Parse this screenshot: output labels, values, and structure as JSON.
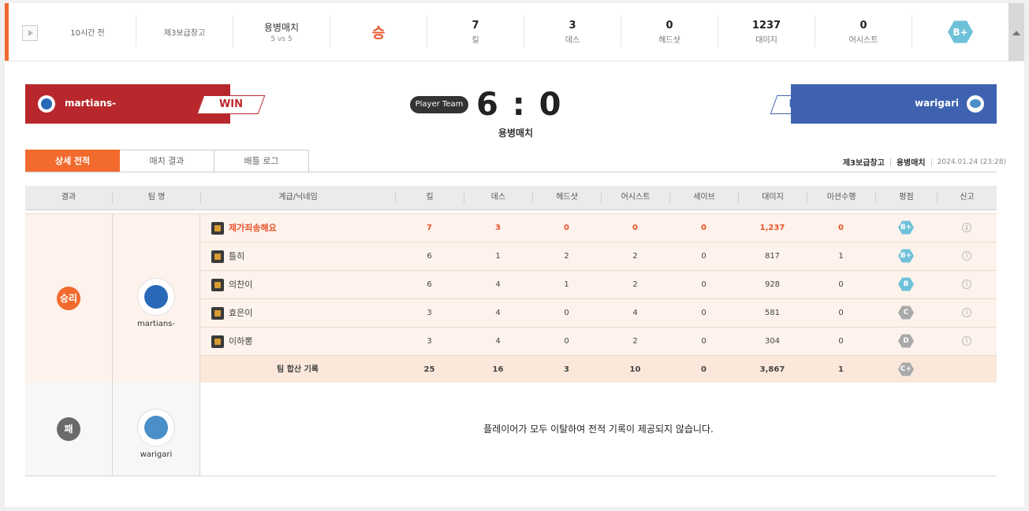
{
  "summary": {
    "time_ago": "10시간 전",
    "map": "제3보급창고",
    "mode": "용병매치",
    "mode_sub": "5 vs 5",
    "result": "승",
    "stats": [
      {
        "value": "7",
        "label": "킬"
      },
      {
        "value": "3",
        "label": "데스"
      },
      {
        "value": "0",
        "label": "헤드샷"
      },
      {
        "value": "1237",
        "label": "대미지"
      },
      {
        "value": "0",
        "label": "어시스트"
      }
    ],
    "grade": "B+"
  },
  "scoreboard": {
    "left_team": "martians-",
    "left_tag": "WIN",
    "right_team": "warigari",
    "right_tag": "LOSE",
    "player_team_badge": "Player Team",
    "score": "6 : 0",
    "mode": "용병매치"
  },
  "tabs": [
    {
      "label": "상세 전적",
      "active": true
    },
    {
      "label": "매치 결과",
      "active": false
    },
    {
      "label": "배틀 로그",
      "active": false
    }
  ],
  "meta": {
    "map": "제3보급창고",
    "mode": "용병매치",
    "datetime": "2024.01.24 (23:28)"
  },
  "table": {
    "headers": [
      "결과",
      "팀 명",
      "계급/닉네임",
      "킬",
      "데스",
      "헤드샷",
      "어시스트",
      "세이브",
      "대미지",
      "미션수행",
      "평점",
      "신고"
    ],
    "win_group": {
      "result": "승리",
      "team": "martians-",
      "players": [
        {
          "nick": "제가죄송해요",
          "kill": "7",
          "death": "3",
          "hs": "0",
          "assist": "0",
          "save": "0",
          "dmg": "1,237",
          "mission": "0",
          "grade": "B+",
          "grade_color": "blue",
          "me": true
        },
        {
          "nick": "틀히",
          "kill": "6",
          "death": "1",
          "hs": "2",
          "assist": "2",
          "save": "0",
          "dmg": "817",
          "mission": "1",
          "grade": "B+",
          "grade_color": "blue",
          "me": false
        },
        {
          "nick": "의찬이",
          "kill": "6",
          "death": "4",
          "hs": "1",
          "assist": "2",
          "save": "0",
          "dmg": "928",
          "mission": "0",
          "grade": "B",
          "grade_color": "blue",
          "me": false
        },
        {
          "nick": "효은이",
          "kill": "3",
          "death": "4",
          "hs": "0",
          "assist": "4",
          "save": "0",
          "dmg": "581",
          "mission": "0",
          "grade": "C",
          "grade_color": "gray",
          "me": false
        },
        {
          "nick": "이하뽕",
          "kill": "3",
          "death": "4",
          "hs": "0",
          "assist": "2",
          "save": "0",
          "dmg": "304",
          "mission": "0",
          "grade": "D",
          "grade_color": "gray",
          "me": false
        }
      ],
      "total": {
        "label": "팀 합산 기록",
        "kill": "25",
        "death": "16",
        "hs": "3",
        "assist": "10",
        "save": "0",
        "dmg": "3,867",
        "mission": "1",
        "grade": "C+",
        "grade_color": "gray"
      }
    },
    "lose_group": {
      "result": "패",
      "team": "warigari",
      "message": "플레이어가 모두 이탈하여 전적 기록이 제공되지 않습니다."
    }
  },
  "colors": {
    "accent": "#f26a2e",
    "win": "#b8272c",
    "lose": "#3f62b0",
    "grade_blue": "#6fc1d9",
    "grade_gray": "#a9a9a9"
  }
}
